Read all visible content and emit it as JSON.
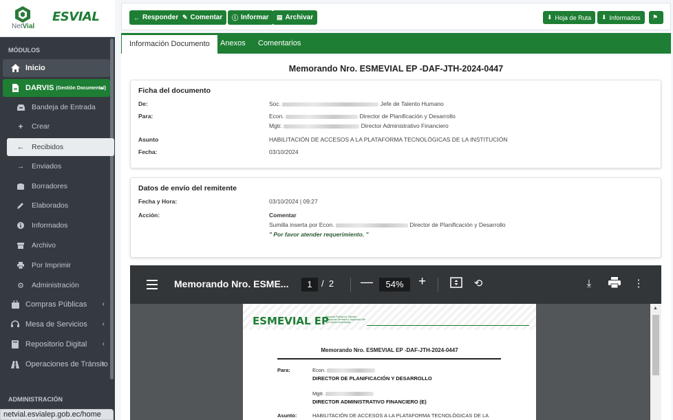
{
  "brand": {
    "netvial_prefix": "Net",
    "netvial_suffix": "Vial",
    "esvial": "ESVIAL"
  },
  "sidebar": {
    "section_modulos": "MÓDULOS",
    "section_administracion": "ADMINISTRACIÓN",
    "items": [
      {
        "label": "Inicio",
        "icon": "home-icon"
      },
      {
        "label": "DARVIS",
        "sub_label": "(Gestión Documental)",
        "icon": "file-icon"
      },
      {
        "label": "Bandeja de Entrada",
        "icon": "inbox-icon"
      },
      {
        "label": "Crear",
        "icon": "plus-icon"
      },
      {
        "label": "Recibidos",
        "icon": "arrow-left-icon"
      },
      {
        "label": "Enviados",
        "icon": "arrow-right-icon"
      },
      {
        "label": "Borradores",
        "icon": "drafts-icon"
      },
      {
        "label": "Elaborados",
        "icon": "pencil-icon"
      },
      {
        "label": "Informados",
        "icon": "info-icon"
      },
      {
        "label": "Archivo",
        "icon": "archive-icon"
      },
      {
        "label": "Por Imprimir",
        "icon": "print-icon"
      },
      {
        "label": "Administración",
        "icon": "gear-icon"
      },
      {
        "label": "Compras Públicas",
        "icon": "shopping-bag-icon"
      },
      {
        "label": "Mesa de Servicios",
        "icon": "headset-icon"
      },
      {
        "label": "Repositorio Digital",
        "icon": "book-icon"
      },
      {
        "label": "Operaciones de Tránsito",
        "icon": "road-icon"
      }
    ]
  },
  "statusbar": {
    "url": "netvial.esvialep.gob.ec/home"
  },
  "toolbar": {
    "responder": "Responder",
    "comentar": "Comentar",
    "informar": "Informar",
    "archivar": "Archivar",
    "hoja_ruta": "Hoja de Ruta",
    "informados": "Informados"
  },
  "tabs": [
    "Información Documento",
    "Anexos",
    "Comentarios"
  ],
  "memo_title": "Memorando Nro. ESMEVIAL EP -DAF-JTH-2024-0447",
  "ficha": {
    "heading": "Ficha del documento",
    "de_label": "De:",
    "de_prefix": "Soc.",
    "de_role": "Jefe de Talento Humano",
    "para_label": "Para:",
    "para1_prefix": "Econ.",
    "para1_role": "Director de Planificación y Desarrollo",
    "para2_prefix": "Mgtr.",
    "para2_role": "Director Administrativo Financiero",
    "asunto_label": "Asunto",
    "asunto": "HABILITACIÓN DE ACCESOS A LA PLATAFORMA TECNOLÓGICAS DE LA INSTITUCIÓN",
    "fecha_label": "Fecha:",
    "fecha": "03/10/2024"
  },
  "envio": {
    "heading": "Datos de envío del remitente",
    "fecha_hora_label": "Fecha y Hora:",
    "fecha_hora": "03/10/2024 | 09:27",
    "accion_label": "Acción:",
    "accion": "Comentar",
    "sumilla_prefix": "Sumilla inserta por Econ.",
    "sumilla_role": "Director de Planificación y Desarrollo",
    "nota": "\" Por favor atender requerimiento. \""
  },
  "pdf": {
    "title": "Memorando Nro. ESME...",
    "page": "1",
    "total": "2",
    "zoom": "54%",
    "logo": "ESMEVIAL EP",
    "logo_sub": "Empresa Pública de Tránsito, Transporte Terrestre y Seguridad Vial del Cantón Esmeraldas",
    "doc_title": "Memorando Nro. ESMEVIAL EP -DAF-JTH-2024-0447",
    "para_label": "Para:",
    "para1_prefix": "Econ.",
    "para1_role": "DIRECTOR DE PLANIFICACIÓN Y DESARROLLO",
    "para2_prefix": "Mgtr.",
    "para2_role": "DIRECTOR ADMINISTRATIVO FINANCIERO (E)",
    "asunto_label": "Asunto:",
    "asunto": "HABILITACIÓN DE ACCESOS A LA PLATAFORMA TECNOLÓGICAS DE LA"
  },
  "colors": {
    "accent": "#1e7e34",
    "sidebar": "#343a40"
  }
}
